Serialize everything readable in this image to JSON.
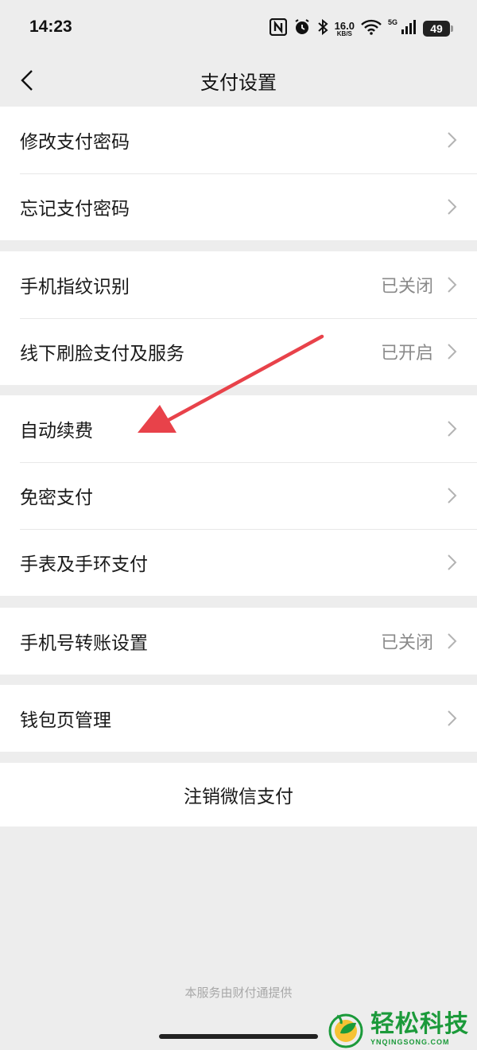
{
  "status_bar": {
    "time": "14:23",
    "net_speed": "16.0",
    "net_speed_unit": "KB/S",
    "signal_label": "5G",
    "battery": "49",
    "icons": [
      "nfc-icon",
      "alarm-icon",
      "bluetooth-icon",
      "wifi-icon",
      "signal-icon",
      "battery-icon"
    ]
  },
  "header": {
    "title": "支付设置",
    "back_icon": "chevron-left-icon"
  },
  "groups": [
    [
      {
        "label": "修改支付密码",
        "value": ""
      },
      {
        "label": "忘记支付密码",
        "value": ""
      }
    ],
    [
      {
        "label": "手机指纹识别",
        "value": "已关闭"
      },
      {
        "label": "线下刷脸支付及服务",
        "value": "已开启"
      }
    ],
    [
      {
        "label": "自动续费",
        "value": ""
      },
      {
        "label": "免密支付",
        "value": ""
      },
      {
        "label": "手表及手环支付",
        "value": ""
      }
    ],
    [
      {
        "label": "手机号转账设置",
        "value": "已关闭"
      }
    ],
    [
      {
        "label": "钱包页管理",
        "value": ""
      }
    ]
  ],
  "deregister": {
    "label": "注销微信支付"
  },
  "footer": {
    "note": "本服务由财付通提供"
  },
  "annotation": {
    "arrow_color": "#e8424a"
  },
  "watermark": {
    "name": "轻松科技",
    "domain": "YNQINGSONG.COM",
    "color": "#1b9a3a"
  }
}
